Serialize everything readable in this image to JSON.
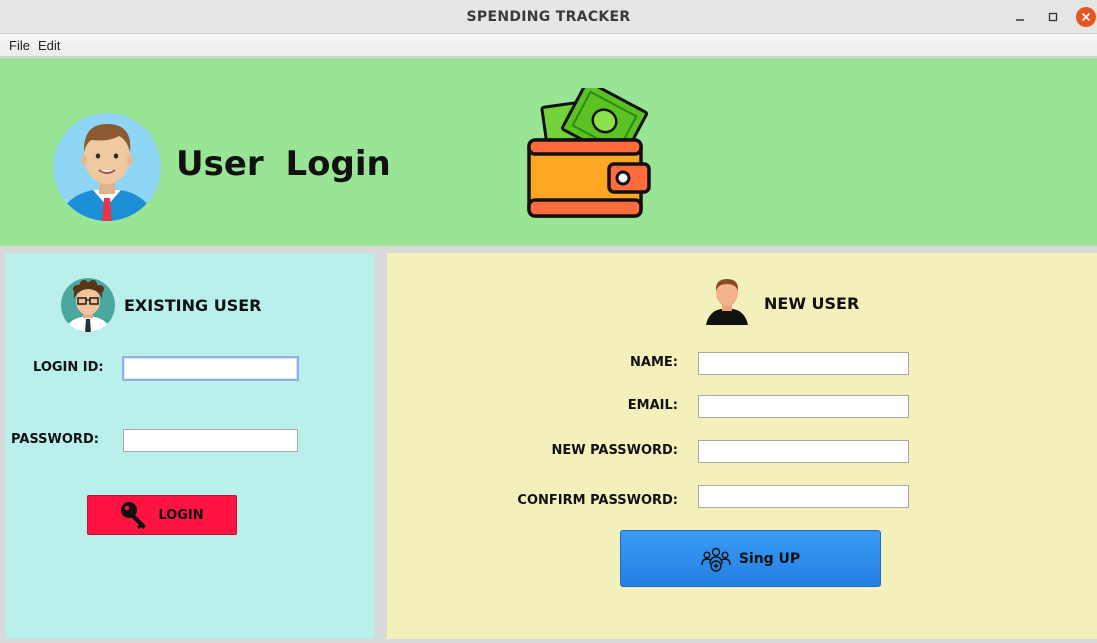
{
  "window": {
    "title": "SPENDING TRACKER",
    "minimize_icon": "minimize-icon",
    "maximize_icon": "maximize-icon",
    "close_icon": "close-icon"
  },
  "menubar": {
    "file": "File",
    "edit": "Edit"
  },
  "header": {
    "title": "User  Login",
    "avatar_icon": "user-avatar-icon",
    "wallet_icon": "wallet-icon"
  },
  "existing_user": {
    "title": "EXISTING USER",
    "avatar_icon": "user-glasses-icon",
    "login_id_label": "LOGIN ID:",
    "login_id_value": "",
    "password_label": "PASSWORD:",
    "password_value": "",
    "login_button": "LOGIN",
    "login_icon": "key-icon",
    "button_color": "#ff1342"
  },
  "new_user": {
    "title": "NEW USER",
    "avatar_icon": "person-icon",
    "name_label": "NAME:",
    "email_label": "EMAIL:",
    "new_password_label": "NEW PASSWORD:",
    "confirm_password_label": "CONFIRM PASSWORD:",
    "name_value": "",
    "email_value": "",
    "new_password_value": "",
    "confirm_password_value": "",
    "signup_button": "Sing UP",
    "signup_icon": "add-users-icon",
    "button_color": "#2a88ec"
  },
  "colors": {
    "header_bg": "#9ae595",
    "left_panel_bg": "#b9f0ec",
    "right_panel_bg": "#f3f0bb"
  }
}
